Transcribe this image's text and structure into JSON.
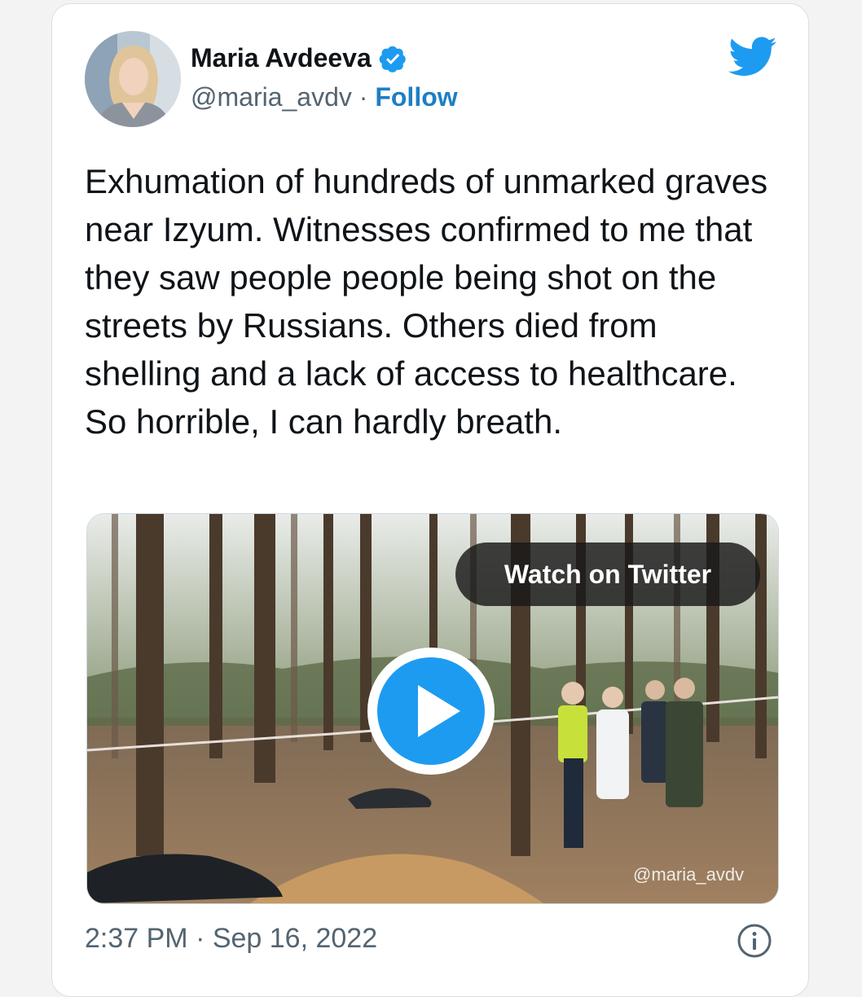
{
  "tweet": {
    "author_name": "Maria Avdeeva",
    "handle": "@maria_avdv",
    "separator": "·",
    "follow_label": "Follow",
    "text": "Exhumation of hundreds of unmarked graves near Izyum. Witnesses confirmed to me that they saw people people being shot on the streets by Russians. Others died from shelling and a lack of access to healthcare. So horrible, I can hardly breath.",
    "timestamp": "2:37 PM · Sep 16, 2022"
  },
  "media": {
    "watch_label": "Watch on Twitter",
    "watermark": "@maria_avdv"
  },
  "icons": {
    "verified": "verified-badge-icon",
    "brand": "twitter-bird-icon",
    "play": "play-icon",
    "info": "info-icon"
  },
  "colors": {
    "link": "#1d7fc4",
    "twitter_blue": "#1d9bf0",
    "text": "#0f1419",
    "muted": "#536471"
  }
}
